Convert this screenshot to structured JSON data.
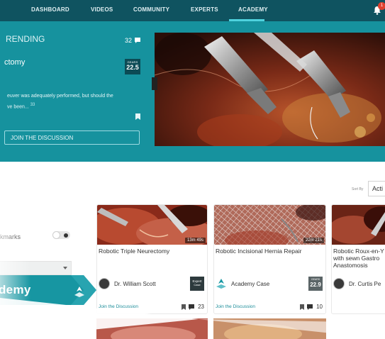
{
  "nav": {
    "items": [
      "DASHBOARD",
      "VIDEOS",
      "COMMUNITY",
      "EXPERTS",
      "ACADEMY"
    ],
    "active": "ACADEMY",
    "notification_count": "1",
    "icons": {
      "bell": "bell-icon"
    }
  },
  "hero": {
    "label": "RENDING",
    "comment_count": "32",
    "title": "ctomy",
    "gears_label": "GEARS",
    "gears_value": "22.5",
    "quote_line1": "euver was adequately performed, but should the",
    "quote_line2": "ve been... ",
    "quote_ref": "33",
    "join_label": "JOIN THE DISCUSSION"
  },
  "sort": {
    "label": "Sort By",
    "value": "Acti"
  },
  "filters": {
    "bookmarks_label": "kmarks",
    "banner_text": "demy"
  },
  "cards": [
    {
      "title": "Robotic Triple Neurectomy",
      "duration": "13m 49s",
      "author": "Dr. William Scott",
      "tag_line1": "Expert",
      "tag_line2": "Case",
      "join": "Join the Discussion",
      "comments": "23"
    },
    {
      "title": "Robotic Incisional Hernia Repair",
      "duration": "22m 21s",
      "author": "Academy Case",
      "tag_line1": "GEARS",
      "tag_line2": "22.9",
      "join": "Join the Discussion",
      "comments": "10"
    },
    {
      "title_line1": "Robotic Roux-en-Y",
      "title_line2": "with sewn Gastro",
      "title_line3": "Anastomosis",
      "author": "Dr. Curtis Pe"
    }
  ],
  "colors": {
    "nav_bg": "#0f5360",
    "hero_bg": "#16929e",
    "accent": "#4fd2de",
    "link": "#1d8e9a"
  }
}
